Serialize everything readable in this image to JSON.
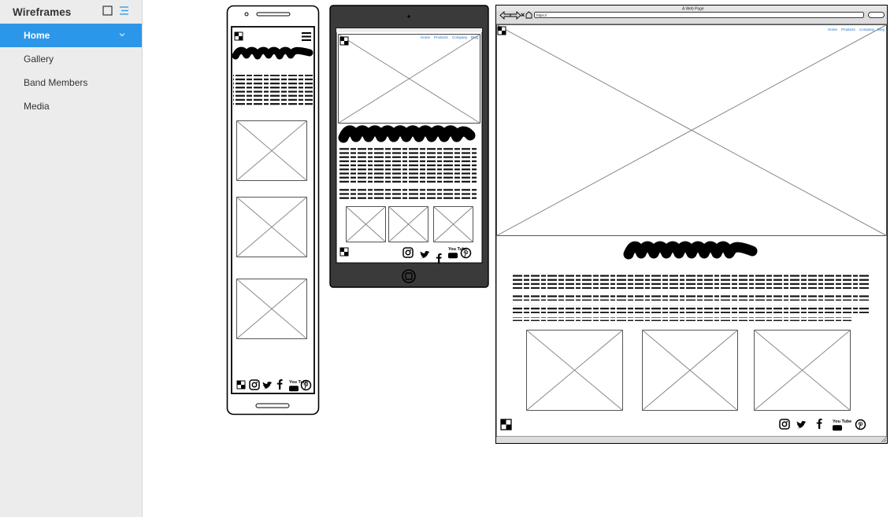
{
  "sidebar": {
    "title": "Wireframes",
    "items": [
      {
        "label": "Home",
        "active": true
      },
      {
        "label": "Gallery",
        "active": false
      },
      {
        "label": "Band Members",
        "active": false
      },
      {
        "label": "Media",
        "active": false
      }
    ]
  },
  "wireframes": {
    "tablet_nav": [
      "Home",
      "Products",
      "Company",
      "Blog"
    ],
    "desktop_nav": [
      "Home",
      "Products",
      "Company",
      "Blog"
    ],
    "browser": {
      "title": "A Web Page",
      "url": "https://"
    },
    "social_icon_youtube_text": "You Tube"
  },
  "colors": {
    "accent": "#2c97e8",
    "sidebar_bg": "#ececec",
    "link": "#1a6fd0"
  }
}
